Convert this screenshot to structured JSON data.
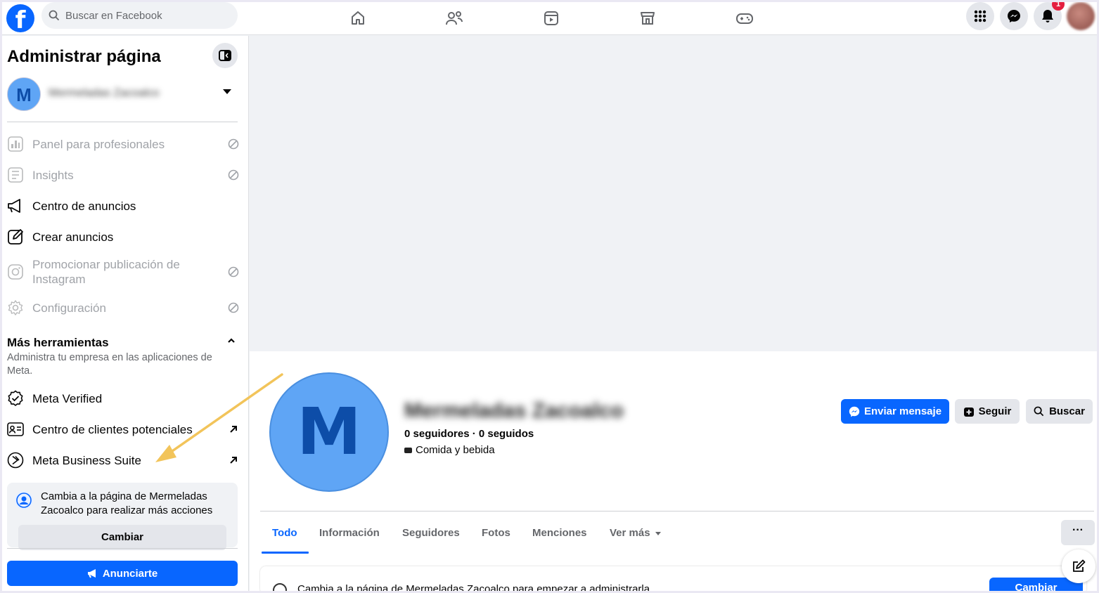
{
  "topnav": {
    "logo": "f",
    "search_placeholder": "Buscar en Facebook",
    "nav_icons": [
      "home-icon",
      "friends-icon",
      "reels-icon",
      "marketplace-icon",
      "gaming-icon"
    ],
    "right_icons": [
      "menu-grid-icon",
      "messenger-icon",
      "bell-icon"
    ],
    "notification_count": "1"
  },
  "sidebar": {
    "title": "Administrar página",
    "page_avatar_letter": "M",
    "page_name": "Mermeladas Zacoalco",
    "items": [
      {
        "label": "Panel para profesionales",
        "icon": "dashboard-icon",
        "disabled": true
      },
      {
        "label": "Insights",
        "icon": "insights-icon",
        "disabled": true
      },
      {
        "label": "Centro de anuncios",
        "icon": "megaphone-icon",
        "disabled": false
      },
      {
        "label": "Crear anuncios",
        "icon": "edit-icon",
        "disabled": false
      },
      {
        "label": "Promocionar publicación de Instagram",
        "icon": "instagram-icon",
        "disabled": true
      },
      {
        "label": "Configuración",
        "icon": "gear-icon",
        "disabled": true
      }
    ],
    "tools": {
      "title": "Más herramientas",
      "description": "Administra tu empresa en las aplicaciones de Meta.",
      "items": [
        {
          "label": "Meta Verified",
          "icon": "verified-icon"
        },
        {
          "label": "Centro de clientes potenciales",
          "icon": "leads-icon"
        },
        {
          "label": "Meta Business Suite",
          "icon": "business-suite-icon"
        }
      ]
    },
    "switch_prompt": "Cambia a la página de Mermeladas Zacoalco para realizar más acciones",
    "switch_button": "Cambiar",
    "advertise_button": "Anunciarte"
  },
  "profile": {
    "avatar_letter": "M",
    "name": "Mermeladas Zacoalco",
    "followers": "0 seguidores · 0 seguidos",
    "category": "Comida y bebida",
    "buttons": {
      "message": "Enviar mensaje",
      "follow": "Seguir",
      "search": "Buscar"
    },
    "tabs": [
      "Todo",
      "Información",
      "Seguidores",
      "Fotos",
      "Menciones",
      "Ver más"
    ],
    "more_button": "···",
    "banner_text": "Cambia a la página de Mermeladas Zacoalco para empezar a administrarla",
    "banner_button": "Cambiar"
  },
  "colors": {
    "brand": "#0866ff",
    "annotation_arrow": "#f2c45a",
    "badge": "#e41e3f"
  }
}
